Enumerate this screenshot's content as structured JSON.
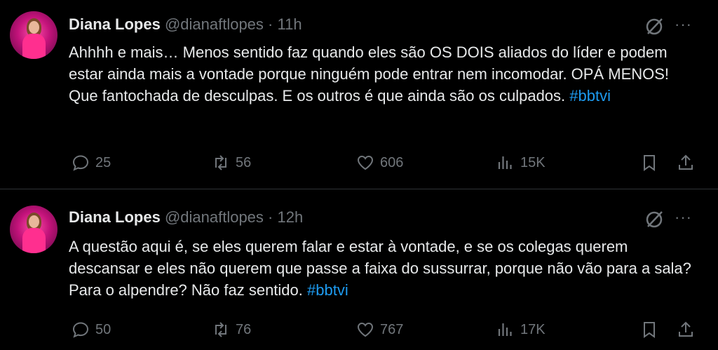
{
  "tweets": [
    {
      "name": "Diana Lopes",
      "handle": "@dianaftlopes",
      "separator": "·",
      "time": "11h",
      "text": "Ahhhh e mais… Menos sentido faz quando eles são OS DOIS aliados do líder e podem estar ainda mais a vontade porque ninguém pode entrar nem incomodar. OPÁ MENOS! Que fantochada de desculpas. E os outros é que ainda são os culpados. ",
      "hashtag": "#bbtvi",
      "replies": "25",
      "reposts": "56",
      "likes": "606",
      "views": "15K"
    },
    {
      "name": "Diana Lopes",
      "handle": "@dianaftlopes",
      "separator": "·",
      "time": "12h",
      "text": "A questão aqui é, se eles querem falar e estar à vontade, e se os colegas querem descansar e eles não querem que passe a faixa do sussurrar, porque não vão para a sala? Para o alpendre? Não faz sentido. ",
      "hashtag": "#bbtvi",
      "replies": "50",
      "reposts": "76",
      "likes": "767",
      "views": "17K"
    }
  ],
  "more_label": "···",
  "icons": [
    "grok-icon",
    "more-icon",
    "reply-icon",
    "repost-icon",
    "like-icon",
    "views-icon",
    "bookmark-icon",
    "share-icon"
  ],
  "colors": {
    "background": "#000000",
    "text": "#e7e9ea",
    "muted": "#71767b",
    "link": "#1d9bf0",
    "divider": "#2f3336"
  }
}
